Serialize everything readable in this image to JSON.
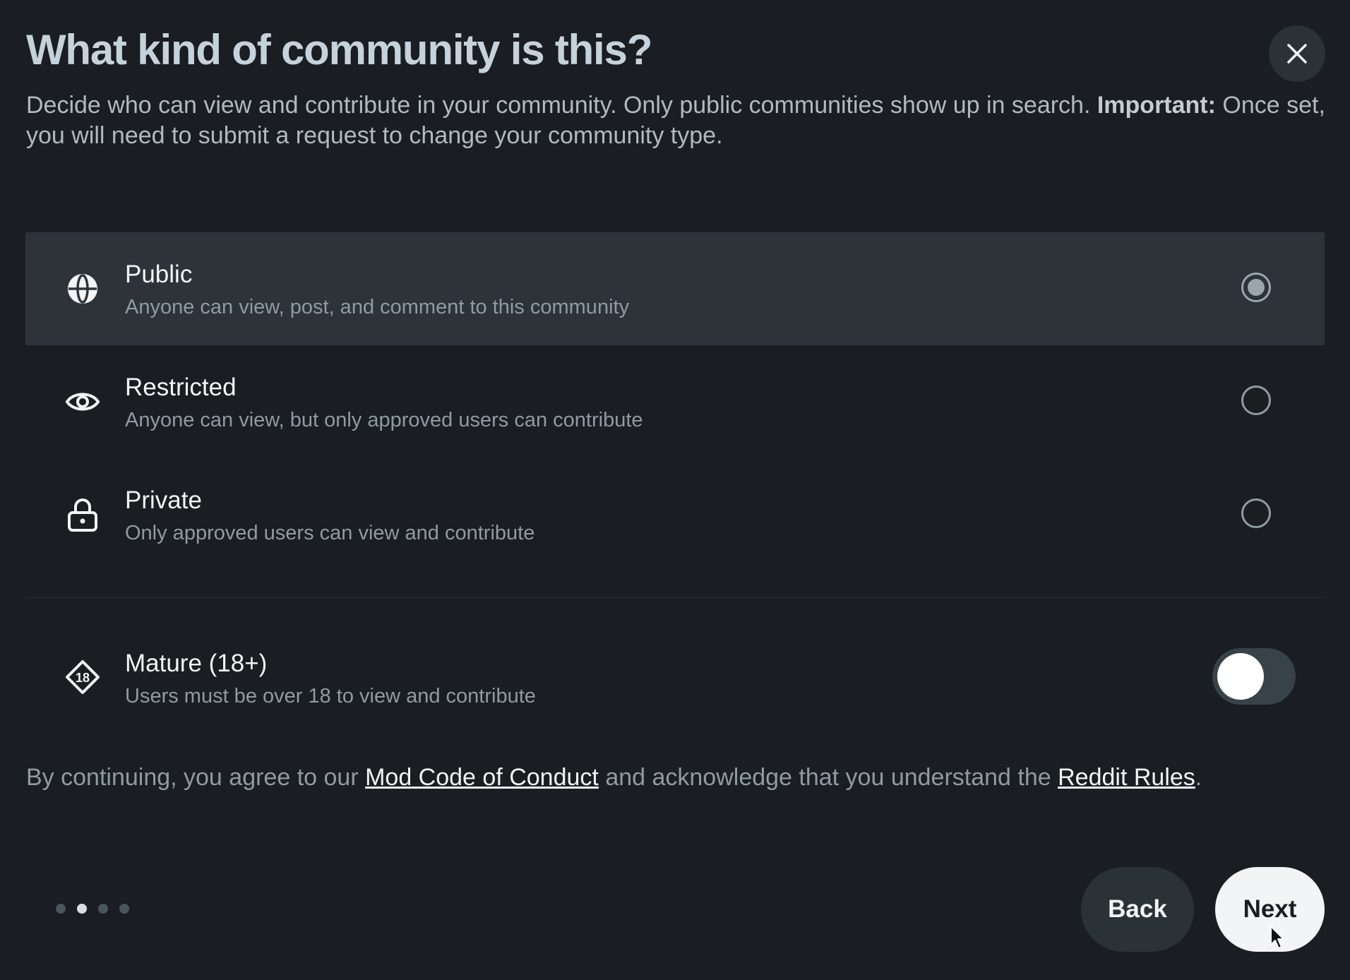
{
  "dialog": {
    "title": "What kind of community is this?",
    "description": "Decide who can view and contribute in your community. Only public communities show up in search.",
    "important_label": "Important:",
    "important_text": "Once set, you will need to submit a request to change your community type."
  },
  "options": [
    {
      "label": "Public",
      "sub": "Anyone can view, post, and comment to this community",
      "icon": "globe-icon",
      "selected": true
    },
    {
      "label": "Restricted",
      "sub": "Anyone can view, but only approved users can contribute",
      "icon": "eye-icon",
      "selected": false
    },
    {
      "label": "Private",
      "sub": "Only approved users can view and contribute",
      "icon": "lock-icon",
      "selected": false
    }
  ],
  "mature": {
    "label": "Mature (18+)",
    "sub": "Users must be over 18 to view and contribute",
    "icon": "18-plus-icon",
    "enabled": false
  },
  "agreement": {
    "prefix": "By continuing, you agree to our",
    "link1": "Mod Code of Conduct",
    "middle": "and acknowledge that you understand the",
    "link2": "Reddit Rules",
    "suffix": "."
  },
  "stepper": {
    "total": 4,
    "current": 2
  },
  "buttons": {
    "back": "Back",
    "next": "Next"
  },
  "colors": {
    "background": "#1a1d21",
    "selected_row": "#2d3339",
    "muted_text": "#8f9ba2"
  }
}
